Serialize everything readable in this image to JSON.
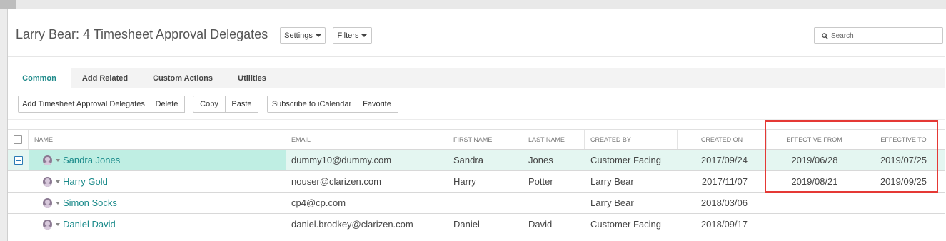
{
  "header": {
    "title": "Larry Bear: 4 Timesheet Approval Delegates",
    "settings_label": "Settings",
    "filters_label": "Filters",
    "search_placeholder": "Search"
  },
  "tabs": [
    {
      "label": "Common",
      "active": true
    },
    {
      "label": "Add Related",
      "active": false
    },
    {
      "label": "Custom Actions",
      "active": false
    },
    {
      "label": "Utilities",
      "active": false
    }
  ],
  "actions": {
    "add_label": "Add Timesheet Approval Delegates",
    "delete_label": "Delete",
    "copy_label": "Copy",
    "paste_label": "Paste",
    "subscribe_label": "Subscribe to iCalendar",
    "favorite_label": "Favorite"
  },
  "grid": {
    "columns": [
      "NAME",
      "EMAIL",
      "FIRST NAME",
      "LAST NAME",
      "CREATED BY",
      "CREATED ON",
      "EFFECTIVE FROM",
      "EFFECTIVE TO"
    ],
    "rows": [
      {
        "name": "Sandra Jones",
        "email": "dummy10@dummy.com",
        "first_name": "Sandra",
        "last_name": "Jones",
        "created_by": "Customer Facing",
        "created_on": "2017/09/24",
        "effective_from": "2019/06/28",
        "effective_to": "2019/07/25",
        "selected": true
      },
      {
        "name": "Harry Gold",
        "email": "nouser@clarizen.com",
        "first_name": "Harry",
        "last_name": "Potter",
        "created_by": "Larry Bear",
        "created_on": "2017/11/07",
        "effective_from": "2019/08/21",
        "effective_to": "2019/09/25",
        "selected": false
      },
      {
        "name": "Simon Socks",
        "email": "cp4@cp.com",
        "first_name": "",
        "last_name": "",
        "created_by": "Larry Bear",
        "created_on": "2018/03/06",
        "effective_from": "",
        "effective_to": "",
        "selected": false
      },
      {
        "name": "Daniel David",
        "email": "daniel.brodkey@clarizen.com",
        "first_name": "Daniel",
        "last_name": "David",
        "created_by": "Customer Facing",
        "created_on": "2018/09/17",
        "effective_from": "",
        "effective_to": "",
        "selected": false
      }
    ]
  },
  "colors": {
    "accent": "#1a8a8a",
    "selected_row": "#e4f6f1",
    "highlight_box": "#e53935"
  }
}
